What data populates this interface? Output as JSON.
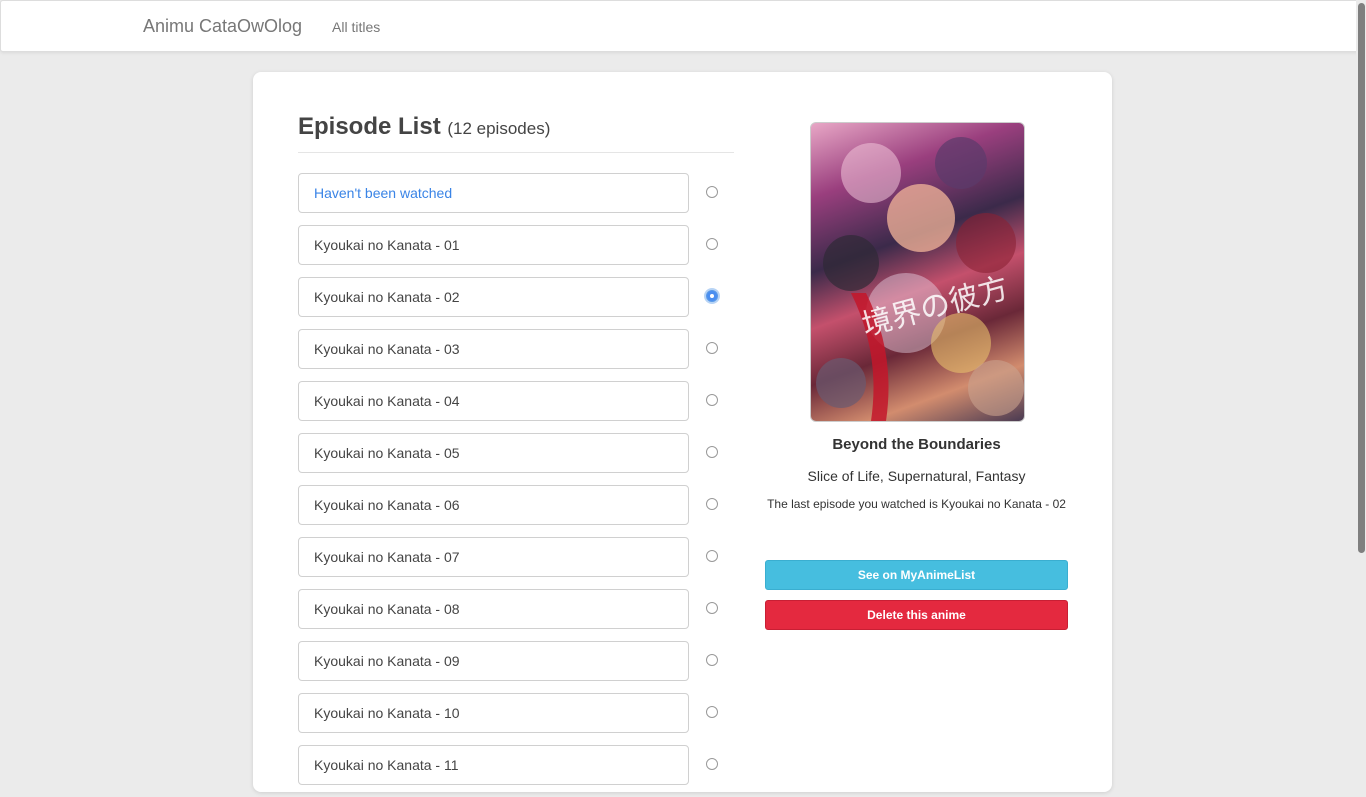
{
  "navbar": {
    "brand": "Animu CataOwOlog",
    "links": [
      "All titles"
    ]
  },
  "episode_list": {
    "heading": "Episode List",
    "count_label": "(12 episodes)",
    "items": [
      {
        "label": "Haven't been watched",
        "checked": false
      },
      {
        "label": "Kyoukai no Kanata - 01",
        "checked": false
      },
      {
        "label": "Kyoukai no Kanata - 02",
        "checked": true
      },
      {
        "label": "Kyoukai no Kanata - 03",
        "checked": false
      },
      {
        "label": "Kyoukai no Kanata - 04",
        "checked": false
      },
      {
        "label": "Kyoukai no Kanata - 05",
        "checked": false
      },
      {
        "label": "Kyoukai no Kanata - 06",
        "checked": false
      },
      {
        "label": "Kyoukai no Kanata - 07",
        "checked": false
      },
      {
        "label": "Kyoukai no Kanata - 08",
        "checked": false
      },
      {
        "label": "Kyoukai no Kanata - 09",
        "checked": false
      },
      {
        "label": "Kyoukai no Kanata - 10",
        "checked": false
      },
      {
        "label": "Kyoukai no Kanata - 11",
        "checked": false
      }
    ]
  },
  "details": {
    "title": "Beyond the Boundaries",
    "genres": "Slice of Life, Supernatural, Fantasy",
    "last_watched": "The last episode you watched is Kyoukai no Kanata - 02",
    "mal_button": "See on MyAnimeList",
    "delete_button": "Delete this anime"
  },
  "colors": {
    "unwatched_link": "#3a84e6",
    "mal_button": "#46bedf",
    "delete_button": "#e4293f"
  }
}
